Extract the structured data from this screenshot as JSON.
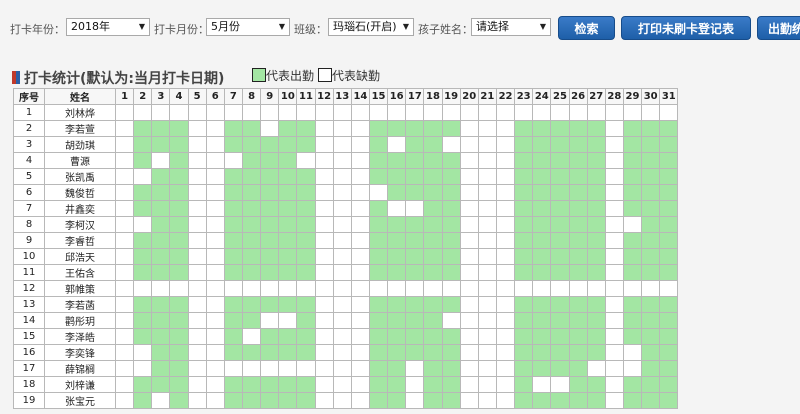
{
  "filters": {
    "year_label": "打卡年份：",
    "year_value": "2018年",
    "month_label": "打卡月份：",
    "month_value": "5月份",
    "class_label": "班级：",
    "class_value": "玛瑙石(开启)",
    "child_label": "孩子姓名：",
    "child_value": "请选择"
  },
  "buttons": {
    "search": "检索",
    "print": "打印未刷卡登记表",
    "attendance": "出勤统计"
  },
  "stats": {
    "title": "打卡统计(默认为:当月打卡日期)",
    "legend_present": "代表出勤",
    "legend_absent": "代表缺勤"
  },
  "colors": {
    "present": "#a3e6a3",
    "absent": "#ffffff",
    "button": "#1e5fa8"
  },
  "table": {
    "col_no": "序号",
    "col_name": "姓名",
    "days": [
      "1",
      "2",
      "3",
      "4",
      "5",
      "6",
      "7",
      "8",
      "9",
      "10",
      "11",
      "12",
      "13",
      "14",
      "15",
      "16",
      "17",
      "18",
      "19",
      "20",
      "21",
      "22",
      "23",
      "24",
      "25",
      "26",
      "27",
      "28",
      "29",
      "30",
      "31"
    ],
    "rows": [
      {
        "no": "1",
        "name": "刘林烨",
        "att": "0000000000000000000000000000000"
      },
      {
        "no": "2",
        "name": "李若萱",
        "att": "0111001101100011111000111110111"
      },
      {
        "no": "3",
        "name": "胡劲琪",
        "att": "0111001111100010110000111110111"
      },
      {
        "no": "4",
        "name": "曹源",
        "att": "0101000111000011111000111110111"
      },
      {
        "no": "5",
        "name": "张凯禹",
        "att": "0011001111100011111000111110111"
      },
      {
        "no": "6",
        "name": "魏俊哲",
        "att": "0111001111100001111000111110111"
      },
      {
        "no": "7",
        "name": "井鑫奕",
        "att": "0111001111100010011000111110111"
      },
      {
        "no": "8",
        "name": "李柯汉",
        "att": "0011001111100011111000111110011"
      },
      {
        "no": "9",
        "name": "李睿哲",
        "att": "0111001111100011111000111110111"
      },
      {
        "no": "10",
        "name": "邱浩天",
        "att": "0111001111100011111000111110111"
      },
      {
        "no": "11",
        "name": "王佑含",
        "att": "0111001111100011111000111110111"
      },
      {
        "no": "12",
        "name": "郭帷策",
        "att": "0000000000000000000000000000000"
      },
      {
        "no": "13",
        "name": "李若菡",
        "att": "0111001111100011111000111110111"
      },
      {
        "no": "14",
        "name": "鹳彤玥",
        "att": "0111001100100011110000111110111"
      },
      {
        "no": "15",
        "name": "李泽皓",
        "att": "0111001011100011111000111110111"
      },
      {
        "no": "16",
        "name": "李奕锋",
        "att": "0011001111100011111000111110011"
      },
      {
        "no": "17",
        "name": "薛锦榈",
        "att": "0011000000000011011000111100011"
      },
      {
        "no": "18",
        "name": "刘梓谦",
        "att": "0111001111100011011000100110111"
      },
      {
        "no": "19",
        "name": "张宝元",
        "att": "0101001111100011011000111110111"
      }
    ]
  }
}
